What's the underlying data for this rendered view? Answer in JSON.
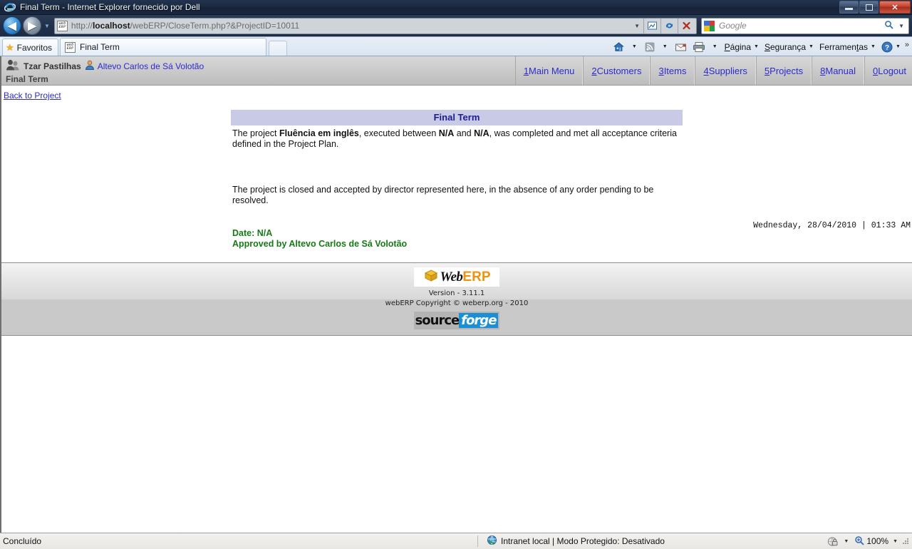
{
  "browser": {
    "window_title": "Final Term - Internet Explorer fornecido por Dell",
    "controls": {
      "minimize": "minimize-icon",
      "maximize": "maximize-icon",
      "close": "✕"
    },
    "nav": {
      "back": "◀",
      "forward": "▶",
      "recent_caret": "▼",
      "address_prefix": "http://",
      "address_host": "localhost",
      "address_path": "/webERP/CloseTerm.php?&ProjectID=10011",
      "address_full": "http://localhost/webERP/CloseTerm.php?&ProjectID=10011",
      "address_caret": "▼",
      "compat_view": "compatibility-view-icon",
      "refresh": "refresh-icon",
      "stop": "✕",
      "favicon_line1": "web",
      "favicon_line2": "ERP"
    },
    "search": {
      "placeholder": "Google",
      "engine_icon": "google-icon",
      "go_icon": "🔍",
      "caret": "▼"
    },
    "tabs": {
      "favorites_label": "Favoritos",
      "favorites_icon": "star-icon",
      "active_tab_label": "Final Term",
      "new_tab_label": ""
    },
    "command_bar": {
      "home_icon": "home-icon",
      "feeds_icon": "rss-icon",
      "mail_icon": "mail-icon",
      "print_icon": "print-icon",
      "items": [
        {
          "accesskey": "P",
          "before": "",
          "key": "P",
          "after": "ágina"
        },
        {
          "accesskey": "S",
          "before": "",
          "key": "S",
          "after": "egurança"
        },
        {
          "accesskey": "t",
          "before": "Ferramen",
          "key": "t",
          "after": "as"
        }
      ],
      "help_icon": "help-icon",
      "overflow": "»"
    },
    "status": {
      "text": "Concluído",
      "zone_icon": "globe-icon",
      "zone": "Intranet local | Modo Protegido: Desativado",
      "privacy_icon": "privacy-report-icon",
      "zoom_icon": "zoom-icon",
      "zoom_level": "100%",
      "caret": "▼"
    }
  },
  "erp": {
    "header": {
      "group_icon": "group-icon",
      "company": "Tzar Pastilhas",
      "user_icon": "user-icon",
      "user": "Altevo Carlos de Sá Volotão",
      "page_name": "Final Term",
      "nav": [
        {
          "key": "1",
          "label": " Main Menu"
        },
        {
          "key": "2",
          "label": " Customers"
        },
        {
          "key": "3",
          "label": " Items"
        },
        {
          "key": "4",
          "label": " Suppliers"
        },
        {
          "key": "5",
          "label": " Projects"
        },
        {
          "key": "8",
          "label": " Manual"
        },
        {
          "key": "0",
          "label": " Logout"
        }
      ]
    },
    "back_link": "Back to Project",
    "document": {
      "title": "Final Term",
      "para1_a": "The project ",
      "para1_project": "Fluência em inglês",
      "para1_b": ", executed between ",
      "para1_start": "N/A",
      "para1_c": " and ",
      "para1_end": "N/A",
      "para1_d": ", was completed and met all acceptance criteria defined in the Project Plan.",
      "para2": "The project is closed and accepted by director represented here, in the absence of any order pending to be resolved.",
      "date_line": "Date: N/A",
      "approved_line": "Approved by Altevo Carlos de Sá Volotão",
      "timestamp": "Wednesday, 28/04/2010 | 01:33 AM"
    },
    "footer": {
      "logo_web": "Web",
      "logo_erp": "ERP",
      "version": "Version - 3.11.1",
      "copyright": "webERP Copyright © weberp.org - 2010",
      "sf_source": "source",
      "sf_forge": "forge"
    }
  },
  "colors": {
    "titlebar": "#1b2a42",
    "link": "#2b2bcf",
    "doc_title_bg": "#c8cae6",
    "doc_title_fg": "#1c1c8f",
    "signature_green": "#177a17",
    "erp_header_bg": "#c9c9c9",
    "close_button": "#c4402c",
    "sf_blue": "#1a8fd6",
    "erp_orange": "#f0920d"
  }
}
